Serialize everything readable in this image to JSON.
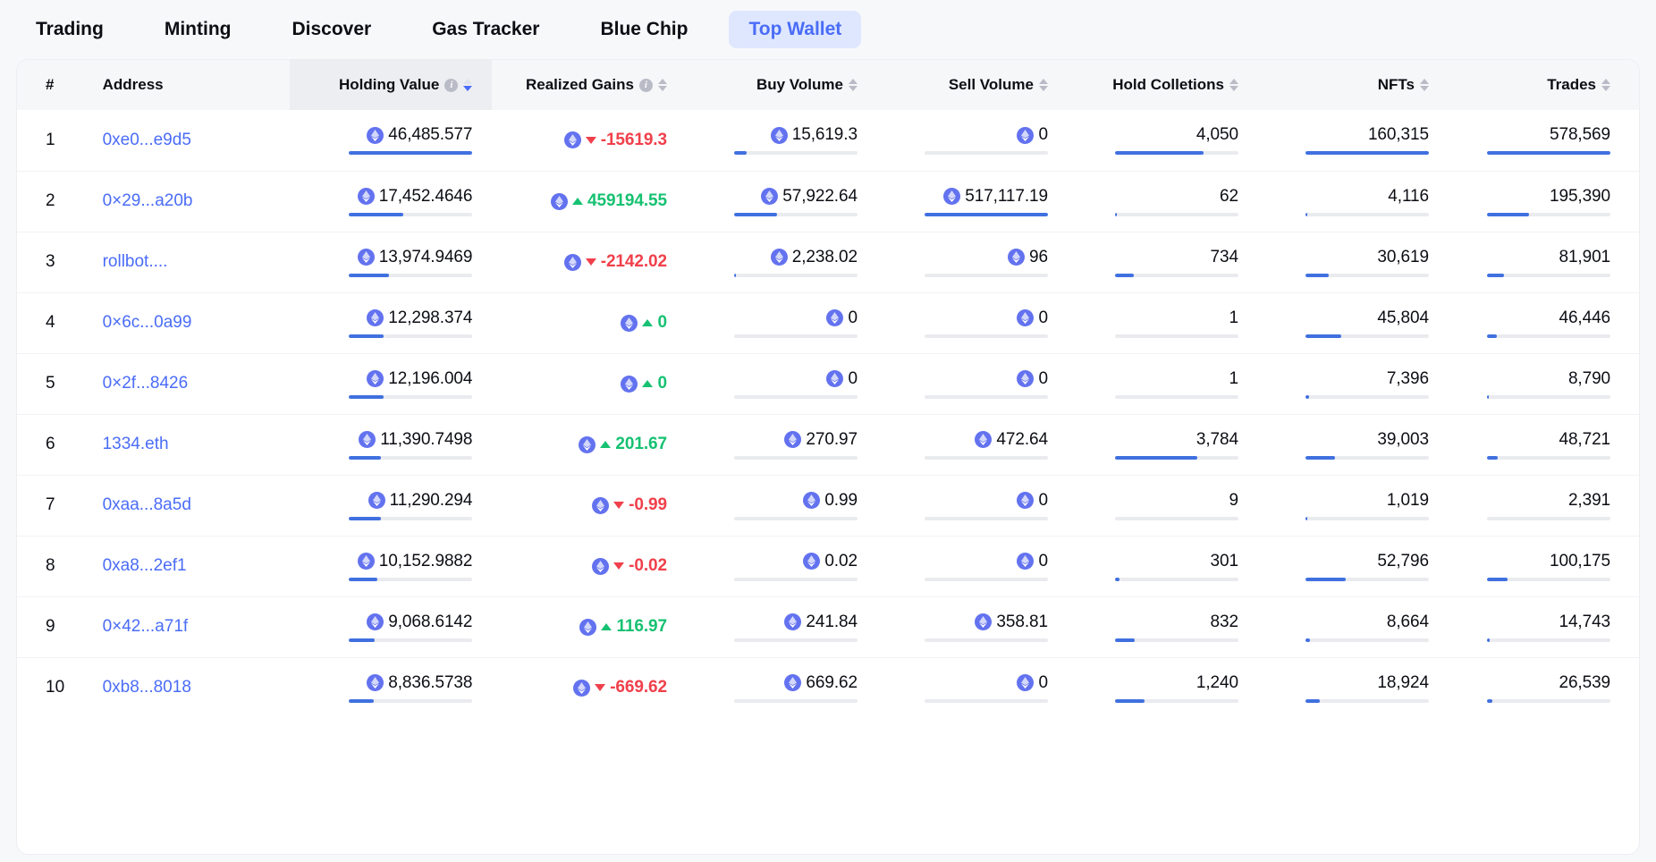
{
  "nav": {
    "items": [
      {
        "label": "Trading",
        "active": false
      },
      {
        "label": "Minting",
        "active": false
      },
      {
        "label": "Discover",
        "active": false
      },
      {
        "label": "Gas Tracker",
        "active": false
      },
      {
        "label": "Blue Chip",
        "active": false
      },
      {
        "label": "Top Wallet",
        "active": true
      }
    ]
  },
  "table": {
    "columns": [
      {
        "key": "rank",
        "label": "#",
        "align": "left",
        "info": false,
        "sortable": false,
        "sorted": false
      },
      {
        "key": "addr",
        "label": "Address",
        "align": "left",
        "info": false,
        "sortable": false,
        "sorted": false
      },
      {
        "key": "hold",
        "label": "Holding Value",
        "align": "right",
        "info": true,
        "sortable": true,
        "sorted": true,
        "sort_dir": "desc"
      },
      {
        "key": "gain",
        "label": "Realized Gains",
        "align": "right",
        "info": true,
        "sortable": true,
        "sorted": false
      },
      {
        "key": "buy",
        "label": "Buy Volume",
        "align": "right",
        "info": false,
        "sortable": true,
        "sorted": false
      },
      {
        "key": "sell",
        "label": "Sell Volume",
        "align": "right",
        "info": false,
        "sortable": true,
        "sorted": false
      },
      {
        "key": "coll",
        "label": "Hold Colletions",
        "align": "right",
        "info": false,
        "sortable": true,
        "sorted": false
      },
      {
        "key": "nft",
        "label": "NFTs",
        "align": "right",
        "info": false,
        "sortable": true,
        "sorted": false
      },
      {
        "key": "trd",
        "label": "Trades",
        "align": "right",
        "info": false,
        "sortable": true,
        "sorted": false
      }
    ],
    "rows": [
      {
        "rank": "1",
        "address": "0xe0...e9d5",
        "holding_value": "46,485.577",
        "holding_bar": 100,
        "realized_gains": "-15619.3",
        "gains_dir": "down",
        "buy_volume": "15,619.3",
        "buy_bar": 10,
        "sell_volume": "0",
        "sell_bar": 0,
        "collections": "4,050",
        "collections_bar": 72,
        "nfts": "160,315",
        "nfts_bar": 100,
        "trades": "578,569",
        "trades_bar": 100
      },
      {
        "rank": "2",
        "address": "0×29...a20b",
        "holding_value": "17,452.4646",
        "holding_bar": 44,
        "realized_gains": "459194.55",
        "gains_dir": "up",
        "buy_volume": "57,922.64",
        "buy_bar": 35,
        "sell_volume": "517,117.19",
        "sell_bar": 100,
        "collections": "62",
        "collections_bar": 1,
        "nfts": "4,116",
        "nfts_bar": 1,
        "trades": "195,390",
        "trades_bar": 34
      },
      {
        "rank": "3",
        "address": "rollbot....",
        "holding_value": "13,974.9469",
        "holding_bar": 32,
        "realized_gains": "-2142.02",
        "gains_dir": "down",
        "buy_volume": "2,238.02",
        "buy_bar": 1,
        "sell_volume": "96",
        "sell_bar": 0,
        "collections": "734",
        "collections_bar": 15,
        "nfts": "30,619",
        "nfts_bar": 19,
        "trades": "81,901",
        "trades_bar": 14
      },
      {
        "rank": "4",
        "address": "0×6c...0a99",
        "holding_value": "12,298.374",
        "holding_bar": 28,
        "realized_gains": "0",
        "gains_dir": "up",
        "buy_volume": "0",
        "buy_bar": 0,
        "sell_volume": "0",
        "sell_bar": 0,
        "collections": "1",
        "collections_bar": 0,
        "nfts": "45,804",
        "nfts_bar": 29,
        "trades": "46,446",
        "trades_bar": 8
      },
      {
        "rank": "5",
        "address": "0×2f...8426",
        "holding_value": "12,196.004",
        "holding_bar": 28,
        "realized_gains": "0",
        "gains_dir": "up",
        "buy_volume": "0",
        "buy_bar": 0,
        "sell_volume": "0",
        "sell_bar": 0,
        "collections": "1",
        "collections_bar": 0,
        "nfts": "7,396",
        "nfts_bar": 3,
        "trades": "8,790",
        "trades_bar": 1
      },
      {
        "rank": "6",
        "address": "1334.eth",
        "holding_value": "11,390.7498",
        "holding_bar": 26,
        "realized_gains": "201.67",
        "gains_dir": "up",
        "buy_volume": "270.97",
        "buy_bar": 0,
        "sell_volume": "472.64",
        "sell_bar": 0,
        "collections": "3,784",
        "collections_bar": 67,
        "nfts": "39,003",
        "nfts_bar": 24,
        "trades": "48,721",
        "trades_bar": 9
      },
      {
        "rank": "7",
        "address": "0xaa...8a5d",
        "holding_value": "11,290.294",
        "holding_bar": 26,
        "realized_gains": "-0.99",
        "gains_dir": "down",
        "buy_volume": "0.99",
        "buy_bar": 0,
        "sell_volume": "0",
        "sell_bar": 0,
        "collections": "9",
        "collections_bar": 0,
        "nfts": "1,019",
        "nfts_bar": 1,
        "trades": "2,391",
        "trades_bar": 0
      },
      {
        "rank": "8",
        "address": "0xa8...2ef1",
        "holding_value": "10,152.9882",
        "holding_bar": 23,
        "realized_gains": "-0.02",
        "gains_dir": "down",
        "buy_volume": "0.02",
        "buy_bar": 0,
        "sell_volume": "0",
        "sell_bar": 0,
        "collections": "301",
        "collections_bar": 4,
        "nfts": "52,796",
        "nfts_bar": 33,
        "trades": "100,175",
        "trades_bar": 17
      },
      {
        "rank": "9",
        "address": "0×42...a71f",
        "holding_value": "9,068.6142",
        "holding_bar": 21,
        "realized_gains": "116.97",
        "gains_dir": "up",
        "buy_volume": "241.84",
        "buy_bar": 0,
        "sell_volume": "358.81",
        "sell_bar": 0,
        "collections": "832",
        "collections_bar": 16,
        "nfts": "8,664",
        "nfts_bar": 4,
        "trades": "14,743",
        "trades_bar": 2
      },
      {
        "rank": "10",
        "address": "0xb8...8018",
        "holding_value": "8,836.5738",
        "holding_bar": 20,
        "realized_gains": "-669.62",
        "gains_dir": "down",
        "buy_volume": "669.62",
        "buy_bar": 0,
        "sell_volume": "0",
        "sell_bar": 0,
        "collections": "1,240",
        "collections_bar": 24,
        "nfts": "18,924",
        "nfts_bar": 12,
        "trades": "26,539",
        "trades_bar": 4
      }
    ]
  },
  "colors": {
    "accent": "#4a6cf7",
    "bar_fill": "#4070e0",
    "bar_track": "#eaebef",
    "positive": "#16c172",
    "negative": "#f0404b",
    "eth_badge": "#6372ef"
  },
  "icons": {
    "info": "i",
    "ethereum": "ethereum-diamond-icon",
    "sort": "sort-arrows-icon"
  }
}
